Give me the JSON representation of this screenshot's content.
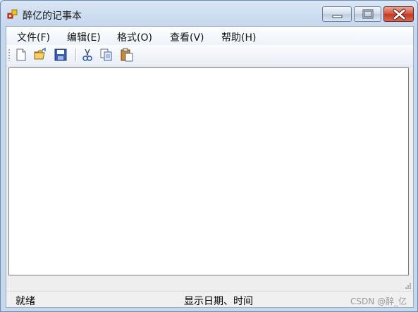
{
  "window": {
    "title": "醉亿的记事本",
    "accent": "#c6d8ee",
    "close_color": "#c13a23"
  },
  "menu": {
    "items": [
      {
        "label": "文件(F)",
        "icon": "none"
      },
      {
        "label": "编辑(E)",
        "icon": "none"
      },
      {
        "label": "格式(O)",
        "icon": "none"
      },
      {
        "label": "查看(V)",
        "icon": "none"
      },
      {
        "label": "帮助(H)",
        "icon": "none"
      }
    ]
  },
  "toolbar": {
    "buttons": [
      "new-file-icon",
      "open-folder-icon",
      "save-disk-icon",
      "cut-scissors-icon",
      "copy-icon",
      "paste-icon"
    ]
  },
  "editor": {
    "value": ""
  },
  "status": {
    "ready": "就绪",
    "datetime": "显示日期、时间"
  },
  "watermark": "CSDN @醉_亿"
}
